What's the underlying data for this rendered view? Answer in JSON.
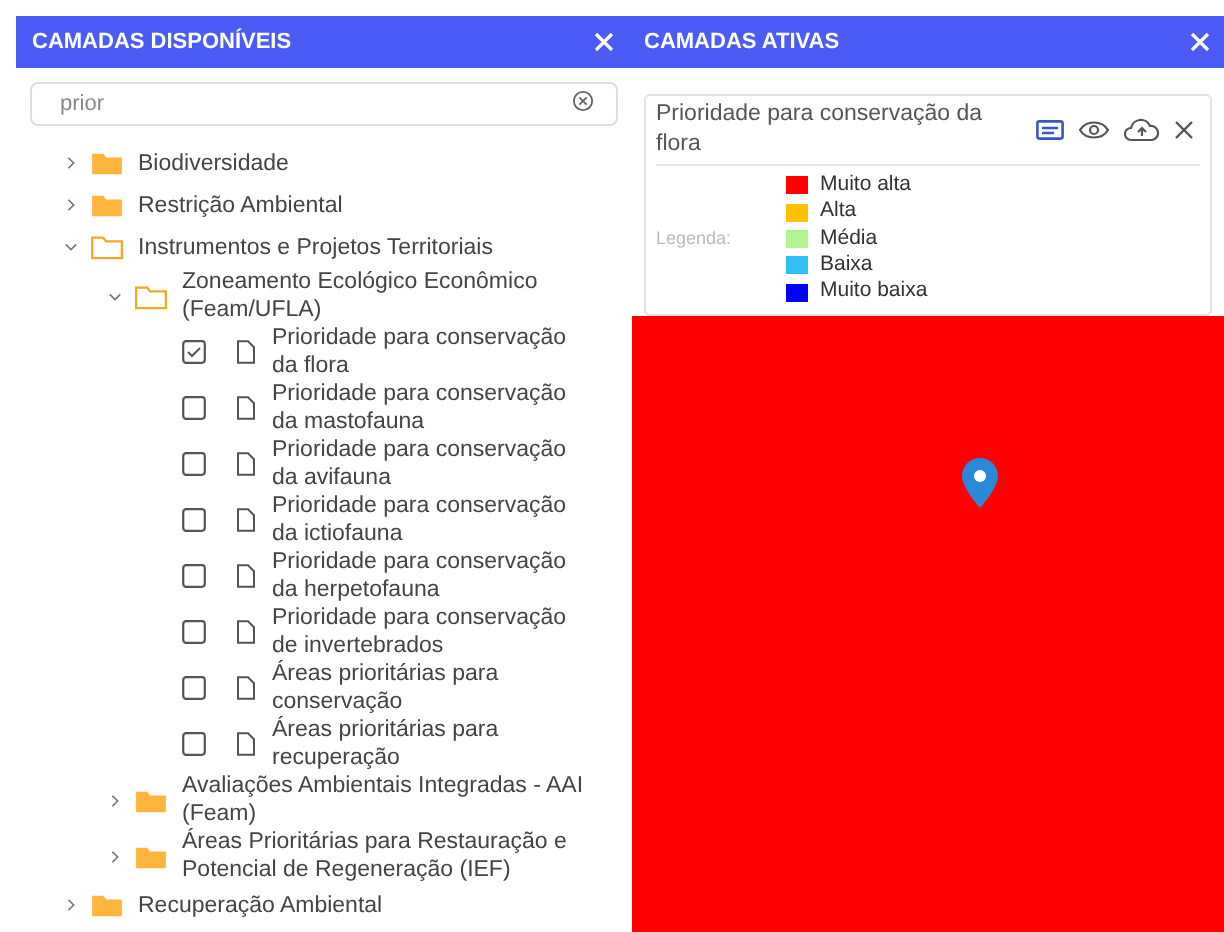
{
  "available_panel": {
    "title": "CAMADAS DISPONÍVEIS",
    "search": {
      "value": "prior"
    },
    "tree": [
      {
        "kind": "folder",
        "label": "Biodiversidade",
        "expanded": false
      },
      {
        "kind": "folder",
        "label": "Restrição Ambiental",
        "expanded": false
      },
      {
        "kind": "folder",
        "label": "Instrumentos e Projetos Territoriais",
        "expanded": true,
        "children": [
          {
            "kind": "folder",
            "label": "Zoneamento Ecológico Econômico (Feam/UFLA)",
            "expanded": true,
            "children": [
              {
                "kind": "layer",
                "label": "Prioridade para conservação da flora",
                "checked": true
              },
              {
                "kind": "layer",
                "label": "Prioridade para conservação da mastofauna",
                "checked": false
              },
              {
                "kind": "layer",
                "label": "Prioridade para conservação da avifauna",
                "checked": false
              },
              {
                "kind": "layer",
                "label": "Prioridade para conservação da ictiofauna",
                "checked": false
              },
              {
                "kind": "layer",
                "label": "Prioridade para conservação da herpetofauna",
                "checked": false
              },
              {
                "kind": "layer",
                "label": "Prioridade para conservação de invertebrados",
                "checked": false
              },
              {
                "kind": "layer",
                "label": "Áreas prioritárias para conservação",
                "checked": false
              },
              {
                "kind": "layer",
                "label": "Áreas prioritárias para recuperação",
                "checked": false
              }
            ]
          },
          {
            "kind": "folder",
            "label": "Avaliações Ambientais Integradas - AAI (Feam)",
            "expanded": false
          },
          {
            "kind": "folder",
            "label": "Áreas Prioritárias para Restauração e Potencial de Regeneração (IEF)",
            "expanded": false
          }
        ]
      },
      {
        "kind": "folder",
        "label": "Recuperação Ambiental",
        "expanded": false
      }
    ]
  },
  "active_panel": {
    "title": "CAMADAS ATIVAS",
    "layers": [
      {
        "title": "Prioridade para conservação da flora",
        "legend_label": "Legenda:",
        "legend": [
          {
            "label": "Muito alta",
            "color": "#ff0000"
          },
          {
            "label": "Alta",
            "color": "#ffc000"
          },
          {
            "label": "Média",
            "color": "#b0f590"
          },
          {
            "label": "Baixa",
            "color": "#30c0f8"
          },
          {
            "label": "Muito baixa",
            "color": "#0000ff"
          }
        ]
      }
    ]
  }
}
